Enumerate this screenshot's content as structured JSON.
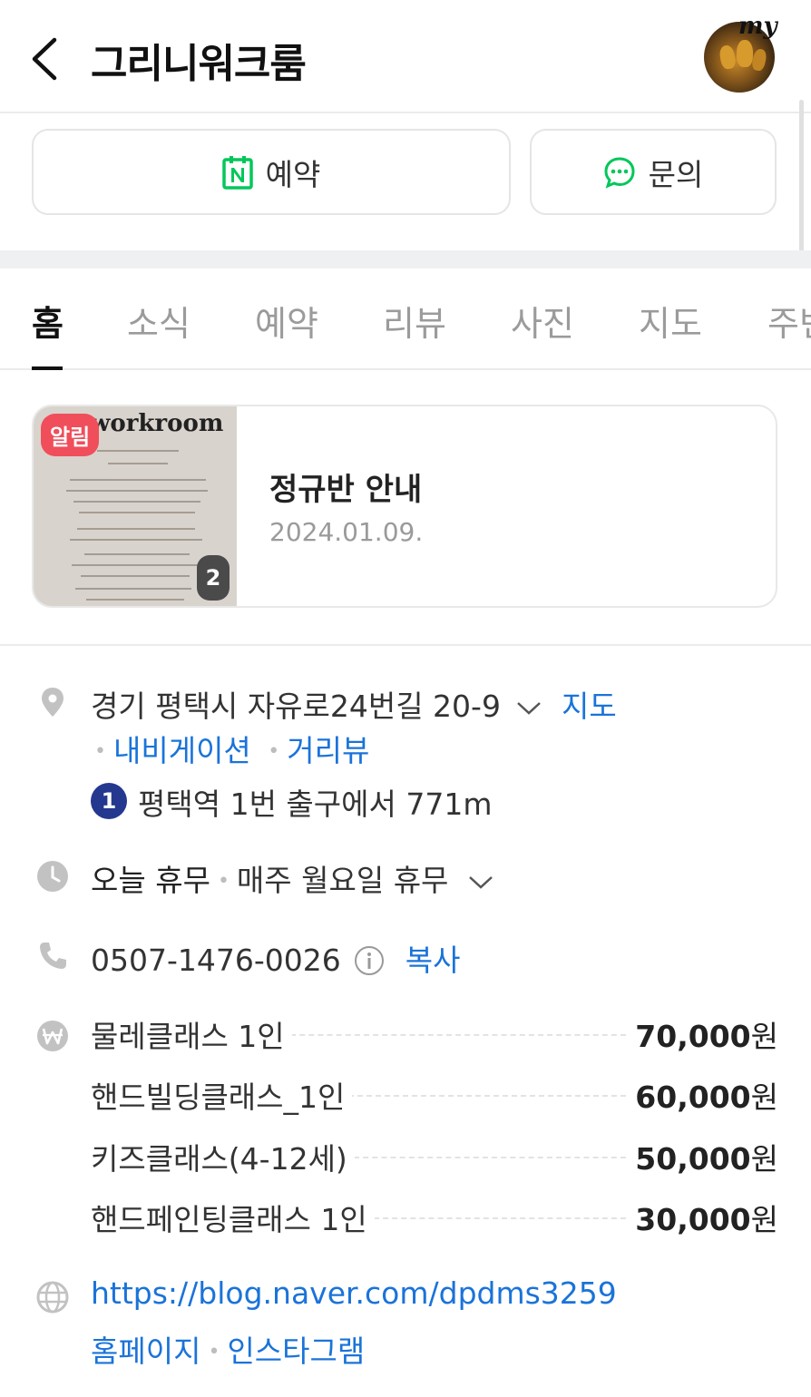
{
  "header": {
    "title": "그리니워크룸",
    "badge": "my"
  },
  "actions": [
    {
      "label": "예약",
      "icon": "naver-calendar-icon"
    },
    {
      "label": "문의",
      "icon": "chat-bubble-icon"
    }
  ],
  "tabs": [
    "홈",
    "소식",
    "예약",
    "리뷰",
    "사진",
    "지도",
    "주변"
  ],
  "active_tab": "홈",
  "notice": {
    "badge": "알림",
    "title": "정규반 안내",
    "date": "2024.01.09.",
    "image_count": "2",
    "thumb_logo": "workroom"
  },
  "info": {
    "address": "경기 평택시 자유로24번길 20-9",
    "map_link": "지도",
    "navigation_link": "내비게이션",
    "streetview_link": "거리뷰",
    "subway_line": "1",
    "subway_text": "평택역 1번 출구에서 771m",
    "hours_status": "오늘 휴무",
    "hours_detail": "매주 월요일 휴무",
    "phone": "0507-1476-0026",
    "copy_label": "복사",
    "prices": [
      {
        "name": "물레클래스 1인",
        "amount": "70,000",
        "unit": "원"
      },
      {
        "name": "핸드빌딩클래스_1인",
        "amount": "60,000",
        "unit": "원"
      },
      {
        "name": "키즈클래스(4-12세)",
        "amount": "50,000",
        "unit": "원"
      },
      {
        "name": "핸드페인팅클래스 1인",
        "amount": "30,000",
        "unit": "원"
      }
    ],
    "website": "https://blog.naver.com/dpdms3259",
    "homepage_link": "홈페이지",
    "instagram_link": "인스타그램"
  },
  "colors": {
    "link": "#1a73d9",
    "naver_green": "#03c75a",
    "alert_red": "#f04e5a",
    "subway_line1": "#24388f"
  }
}
